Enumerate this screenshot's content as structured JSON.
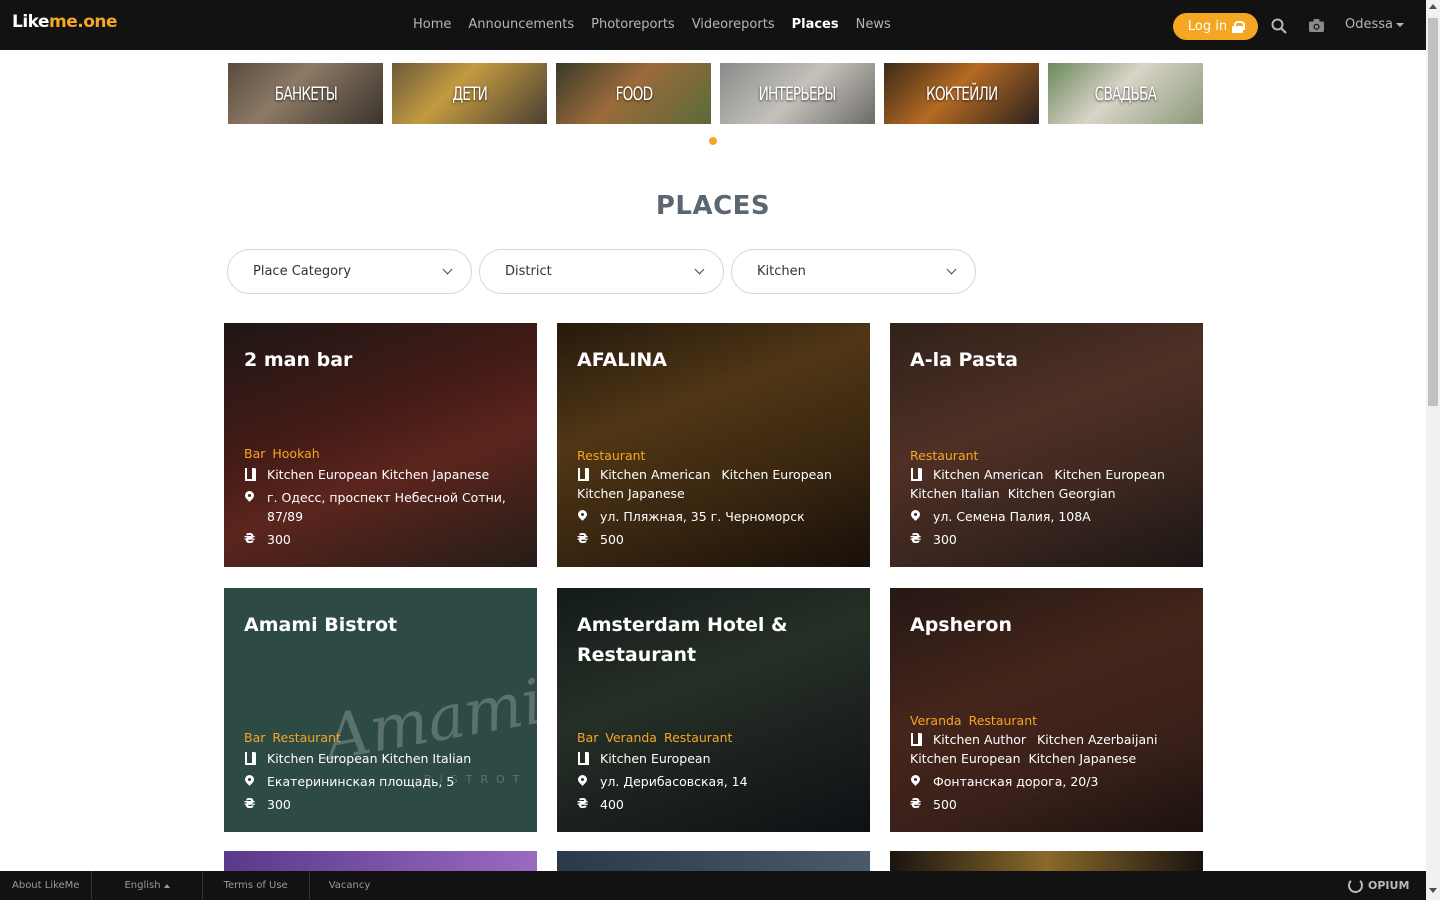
{
  "header": {
    "logo": {
      "part1": "Like",
      "part2": "me.one"
    },
    "nav": [
      "Home",
      "Announcements",
      "Photoreports",
      "Videoreports",
      "Places",
      "News"
    ],
    "active_nav": "Places",
    "login_label": "Log in",
    "city": "Odessa"
  },
  "categories": [
    "БАНКЕТЫ",
    "ДЕТИ",
    "FOOD",
    "ИНТЕРЬЕРЫ",
    "КОКТЕЙЛИ",
    "СВАДЬБА"
  ],
  "page_title": "PLACES",
  "filters": {
    "category": "Place Category",
    "district": "District",
    "kitchen": "Kitchen"
  },
  "places": [
    {
      "name": "2 man bar",
      "categories": [
        "Bar",
        "Hookah"
      ],
      "kitchens": [
        "Kitchen European",
        "Kitchen Japanese"
      ],
      "address": "г. Одесс, проспект Небесной Сотни, 87/89",
      "price": "300"
    },
    {
      "name": "AFALINA",
      "categories": [
        "Restaurant"
      ],
      "kitchens": [
        "Kitchen American",
        "Kitchen European",
        "Kitchen Japanese"
      ],
      "address": "ул. Пляжная, 35 г. Черноморск",
      "price": "500"
    },
    {
      "name": "A-la Pasta",
      "categories": [
        "Restaurant"
      ],
      "kitchens": [
        "Kitchen American",
        "Kitchen European",
        "Kitchen Italian",
        "Kitchen Georgian"
      ],
      "address": "ул. Семена Палия, 108А",
      "price": "300"
    },
    {
      "name": "Amami Bistrot",
      "categories": [
        "Bar",
        "Restaurant"
      ],
      "kitchens": [
        "Kitchen European",
        "Kitchen Italian"
      ],
      "address": "Екатерининская площадь, 5",
      "price": "300"
    },
    {
      "name": "Amsterdam Hotel & Restaurant",
      "categories": [
        "Bar",
        "Veranda",
        "Restaurant"
      ],
      "kitchens": [
        "Kitchen European"
      ],
      "address": "ул. Дерибасовская, 14",
      "price": "400"
    },
    {
      "name": "Apsheron",
      "categories": [
        "Veranda",
        "Restaurant"
      ],
      "kitchens": [
        "Kitchen Author",
        "Kitchen Azerbaijani",
        "Kitchen European",
        "Kitchen Japanese"
      ],
      "address": "Фонтанская дорога, 20/3",
      "price": "500"
    }
  ],
  "footer": {
    "about": "About LikeMe",
    "language": "English",
    "terms": "Terms of Use",
    "vacancy": "Vacancy",
    "brand": "OPIUM"
  },
  "icons": {
    "kitchen": "fork-knife-icon",
    "address": "map-pin-icon",
    "price": "hryvnia-icon",
    "price_symbol": "₴"
  },
  "colors": {
    "accent": "#f5a623",
    "header_bg": "#121212",
    "title": "#5b6670"
  }
}
